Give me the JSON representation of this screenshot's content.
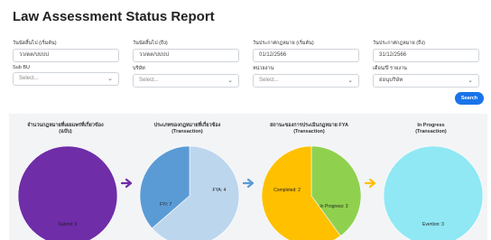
{
  "title": "Law Assessment Status Report",
  "filters": {
    "date_from": {
      "label": "วันนัดสิ้นไป (เริ่มต้น)",
      "value": "วว/ดด/ปปปป"
    },
    "date_to": {
      "label": "วันนัดสิ้นไป (ถึง)",
      "value": "วว/ดด/ปปปป"
    },
    "law_date_from": {
      "label": "วันประกาศกฎหมาย (เริ่มต้น)",
      "value": "01/12/2566"
    },
    "law_date_to": {
      "label": "วันประกาศกฎหมาย (ถึง)",
      "value": "31/12/2566"
    },
    "sub_bu": {
      "label": "Sub BU",
      "value": "Select..."
    },
    "company": {
      "label": "บริษัท",
      "value": "Select..."
    },
    "agency": {
      "label": "หน่วยงาน",
      "value": "Select..."
    },
    "period": {
      "label": "เดือน/ปี รายงาน",
      "value": "ย่อนุบริษัท"
    }
  },
  "search_label": "Search",
  "charts": [
    {
      "title_line1": "จำนวนกฎหมายที่เผยแพร่ที่เกี่ยวข้อง",
      "title_line2": "(ฉบับ)",
      "label": "Submit: 9"
    },
    {
      "title_line1": "ประเภทของกฎหมายที่เกี่ยวข้อง",
      "title_line2": "(Transaction)",
      "label_a": "FYI: 7",
      "label_b": "FYA: 4"
    },
    {
      "title_line1": "สถานะของการประเมินกฎหมาย FYA",
      "title_line2": "(Transaction)",
      "label_a": "Completed: 2",
      "label_b": "In Progress: 3"
    },
    {
      "title_line1": "In Progress",
      "title_line2": "(Transaction)",
      "label": "Evertion: 3"
    }
  ],
  "chart_data": [
    {
      "type": "pie",
      "title": "จำนวนกฎหมายที่เผยแพร่ที่เกี่ยวข้อง (ฉบับ)",
      "categories": [
        "Submit"
      ],
      "values": [
        9
      ],
      "colors": [
        "#6f2da8"
      ]
    },
    {
      "type": "pie",
      "title": "ประเภทของกฎหมายที่เกี่ยวข้อง (Transaction)",
      "categories": [
        "FYI",
        "FYA"
      ],
      "values": [
        7,
        4
      ],
      "colors": [
        "#bcd6ee",
        "#5b9bd5"
      ]
    },
    {
      "type": "pie",
      "title": "สถานะของการประเมินกฎหมาย FYA (Transaction)",
      "categories": [
        "Completed",
        "In Progress"
      ],
      "values": [
        2,
        3
      ],
      "colors": [
        "#8fd14f",
        "#ffc000"
      ]
    },
    {
      "type": "pie",
      "title": "In Progress (Transaction)",
      "categories": [
        "Evertion"
      ],
      "values": [
        3
      ],
      "colors": [
        "#8fe8f4"
      ]
    }
  ],
  "arrow_colors": [
    "#6f2da8",
    "#5b9bd5",
    "#ffc000"
  ]
}
